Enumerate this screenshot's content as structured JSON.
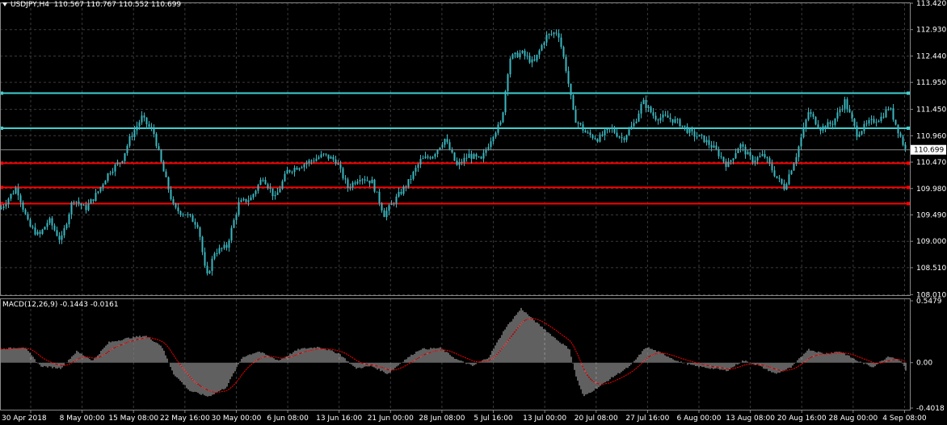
{
  "header": {
    "symbol": "USDJPY,H4",
    "ohlc": "110.567 110.767 110.552 110.699"
  },
  "macd_header": {
    "label": "MACD(12,26,9)",
    "values": "-0.1443 -0.0161"
  },
  "price_axis": {
    "ticks": [
      "113.420",
      "112.930",
      "112.440",
      "111.950",
      "111.450",
      "110.960",
      "110.470",
      "109.980",
      "109.490",
      "109.000",
      "108.510",
      "108.010"
    ],
    "current_price": "110.699"
  },
  "macd_axis": {
    "ticks": [
      "0.5479",
      "0.00",
      "-0.4018"
    ]
  },
  "time_axis": {
    "labels": [
      "30 Apr 2018",
      "8 May 00:00",
      "15 May 08:00",
      "22 May 16:00",
      "30 May 00:00",
      "6 Jun 08:00",
      "13 Jun 16:00",
      "21 Jun 00:00",
      "28 Jun 08:00",
      "5 Jul 16:00",
      "13 Jul 00:00",
      "20 Jul 08:00",
      "27 Jul 16:00",
      "6 Aug 00:00",
      "13 Aug 08:00",
      "20 Aug 16:00",
      "28 Aug 00:00",
      "4 Sep 08:00"
    ]
  },
  "horizontal_lines": [
    {
      "price": 111.75,
      "color": "#40d0d0"
    },
    {
      "price": 111.1,
      "color": "#40d0d0"
    },
    {
      "price": 110.45,
      "color": "#ff0000"
    },
    {
      "price": 110.0,
      "color": "#ff0000"
    },
    {
      "price": 109.7,
      "color": "#ff0000"
    }
  ],
  "colors": {
    "background": "#000000",
    "candle": "#3ab7c0",
    "grid": "#3a3a3a",
    "macd_hist": "#c0c0c0",
    "macd_signal": "#ff0000"
  },
  "chart_data": {
    "type": "candlestick",
    "symbol": "USDJPY",
    "timeframe": "H4",
    "ylim": [
      108.0,
      113.42
    ],
    "close_path": [
      [
        0,
        109.6
      ],
      [
        20,
        110.0
      ],
      [
        35,
        109.3
      ],
      [
        48,
        109.1
      ],
      [
        60,
        109.4
      ],
      [
        75,
        109.0
      ],
      [
        90,
        109.8
      ],
      [
        105,
        109.6
      ],
      [
        120,
        109.9
      ],
      [
        135,
        110.3
      ],
      [
        150,
        110.5
      ],
      [
        160,
        110.9
      ],
      [
        175,
        111.3
      ],
      [
        190,
        111.0
      ],
      [
        200,
        110.4
      ],
      [
        215,
        109.6
      ],
      [
        230,
        109.5
      ],
      [
        245,
        109.3
      ],
      [
        255,
        108.3
      ],
      [
        265,
        108.8
      ],
      [
        280,
        108.9
      ],
      [
        295,
        109.7
      ],
      [
        310,
        109.8
      ],
      [
        325,
        110.2
      ],
      [
        340,
        109.8
      ],
      [
        355,
        110.3
      ],
      [
        370,
        110.4
      ],
      [
        385,
        110.5
      ],
      [
        400,
        110.6
      ],
      [
        415,
        110.5
      ],
      [
        430,
        110.0
      ],
      [
        445,
        110.2
      ],
      [
        460,
        110.1
      ],
      [
        475,
        109.5
      ],
      [
        490,
        109.8
      ],
      [
        505,
        110.1
      ],
      [
        520,
        110.5
      ],
      [
        535,
        110.6
      ],
      [
        550,
        110.9
      ],
      [
        565,
        110.4
      ],
      [
        580,
        110.6
      ],
      [
        595,
        110.5
      ],
      [
        610,
        111.0
      ],
      [
        620,
        111.2
      ],
      [
        630,
        112.4
      ],
      [
        645,
        112.5
      ],
      [
        660,
        112.3
      ],
      [
        675,
        112.8
      ],
      [
        690,
        112.9
      ],
      [
        700,
        112.2
      ],
      [
        710,
        111.3
      ],
      [
        725,
        111.0
      ],
      [
        740,
        110.9
      ],
      [
        755,
        111.1
      ],
      [
        770,
        110.9
      ],
      [
        785,
        111.2
      ],
      [
        795,
        111.6
      ],
      [
        810,
        111.3
      ],
      [
        825,
        111.3
      ],
      [
        840,
        111.2
      ],
      [
        855,
        111.0
      ],
      [
        870,
        110.9
      ],
      [
        885,
        110.7
      ],
      [
        900,
        110.4
      ],
      [
        915,
        110.8
      ],
      [
        930,
        110.5
      ],
      [
        945,
        110.6
      ],
      [
        960,
        110.2
      ],
      [
        970,
        110.0
      ],
      [
        985,
        110.6
      ],
      [
        1000,
        111.4
      ],
      [
        1015,
        111.1
      ],
      [
        1030,
        111.2
      ],
      [
        1045,
        111.6
      ],
      [
        1060,
        111.0
      ],
      [
        1075,
        111.2
      ],
      [
        1090,
        111.3
      ],
      [
        1100,
        111.5
      ],
      [
        1110,
        111.1
      ],
      [
        1120,
        110.7
      ]
    ],
    "macd_ylim": [
      -0.4018,
      0.5479
    ],
    "macd_path": [
      [
        0,
        0.12
      ],
      [
        30,
        0.14
      ],
      [
        50,
        -0.03
      ],
      [
        75,
        -0.05
      ],
      [
        95,
        0.1
      ],
      [
        115,
        0.02
      ],
      [
        135,
        0.18
      ],
      [
        160,
        0.22
      ],
      [
        180,
        0.24
      ],
      [
        200,
        0.15
      ],
      [
        215,
        -0.1
      ],
      [
        235,
        -0.25
      ],
      [
        258,
        -0.3
      ],
      [
        280,
        -0.22
      ],
      [
        300,
        0.05
      ],
      [
        320,
        0.1
      ],
      [
        345,
        0.02
      ],
      [
        370,
        0.12
      ],
      [
        395,
        0.14
      ],
      [
        420,
        0.08
      ],
      [
        440,
        -0.05
      ],
      [
        460,
        -0.03
      ],
      [
        480,
        -0.1
      ],
      [
        500,
        0.02
      ],
      [
        520,
        0.12
      ],
      [
        545,
        0.13
      ],
      [
        565,
        0.03
      ],
      [
        585,
        -0.03
      ],
      [
        605,
        0.05
      ],
      [
        625,
        0.3
      ],
      [
        645,
        0.48
      ],
      [
        665,
        0.35
      ],
      [
        690,
        0.2
      ],
      [
        705,
        0.12
      ],
      [
        712,
        -0.1
      ],
      [
        722,
        -0.3
      ],
      [
        740,
        -0.22
      ],
      [
        760,
        -0.12
      ],
      [
        780,
        -0.03
      ],
      [
        800,
        0.14
      ],
      [
        820,
        0.08
      ],
      [
        840,
        0.01
      ],
      [
        860,
        -0.03
      ],
      [
        880,
        -0.05
      ],
      [
        900,
        -0.07
      ],
      [
        920,
        0.02
      ],
      [
        940,
        -0.03
      ],
      [
        960,
        -0.1
      ],
      [
        980,
        -0.04
      ],
      [
        1000,
        0.12
      ],
      [
        1020,
        0.08
      ],
      [
        1040,
        0.1
      ],
      [
        1060,
        0.02
      ],
      [
        1080,
        -0.04
      ],
      [
        1100,
        0.06
      ],
      [
        1115,
        0.02
      ],
      [
        1122,
        -0.08
      ]
    ]
  }
}
